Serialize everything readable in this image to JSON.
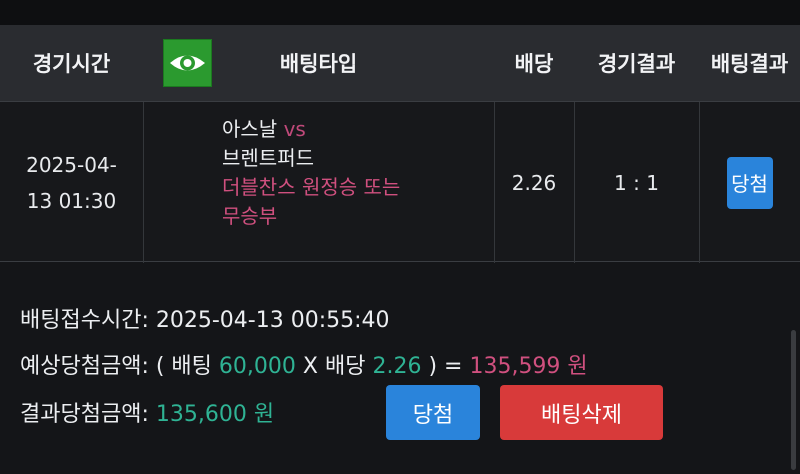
{
  "header": {
    "col_time": "경기시간",
    "col_type": "배팅타입",
    "col_odds": "배당",
    "col_result": "경기결과",
    "col_bet_result": "배팅결과"
  },
  "bet": {
    "time_line1": "2025-04-",
    "time_line2": "13 01:30",
    "home_team": "아스날",
    "vs": "vs",
    "away_team": "브렌트퍼드",
    "pick_line1": "더블찬스 원정승 또는",
    "pick_line2": "무승부",
    "odds": "2.26",
    "score": "1 : 1",
    "status": "당첨",
    "logo_icon": "eye-logo-icon"
  },
  "summary": {
    "received_label": "배팅접수시간:",
    "received_value": "2025-04-13 00:55:40",
    "expected_label": "예상당첨금액:",
    "open_paren": "( 배팅",
    "stake": "60,000",
    "x_odds_label": "X 배당",
    "odds": "2.26",
    "close_paren": ") =",
    "expected_amount": "135,599 원",
    "result_label": "결과당첨금액:",
    "result_amount": "135,600 원"
  },
  "buttons": {
    "win_label": "당첨",
    "delete_label": "배팅삭제"
  },
  "colors": {
    "accent_blue": "#2a84db",
    "delete_red": "#d83a3a",
    "green_text": "#2fb394",
    "pink_text": "#d0507f"
  }
}
